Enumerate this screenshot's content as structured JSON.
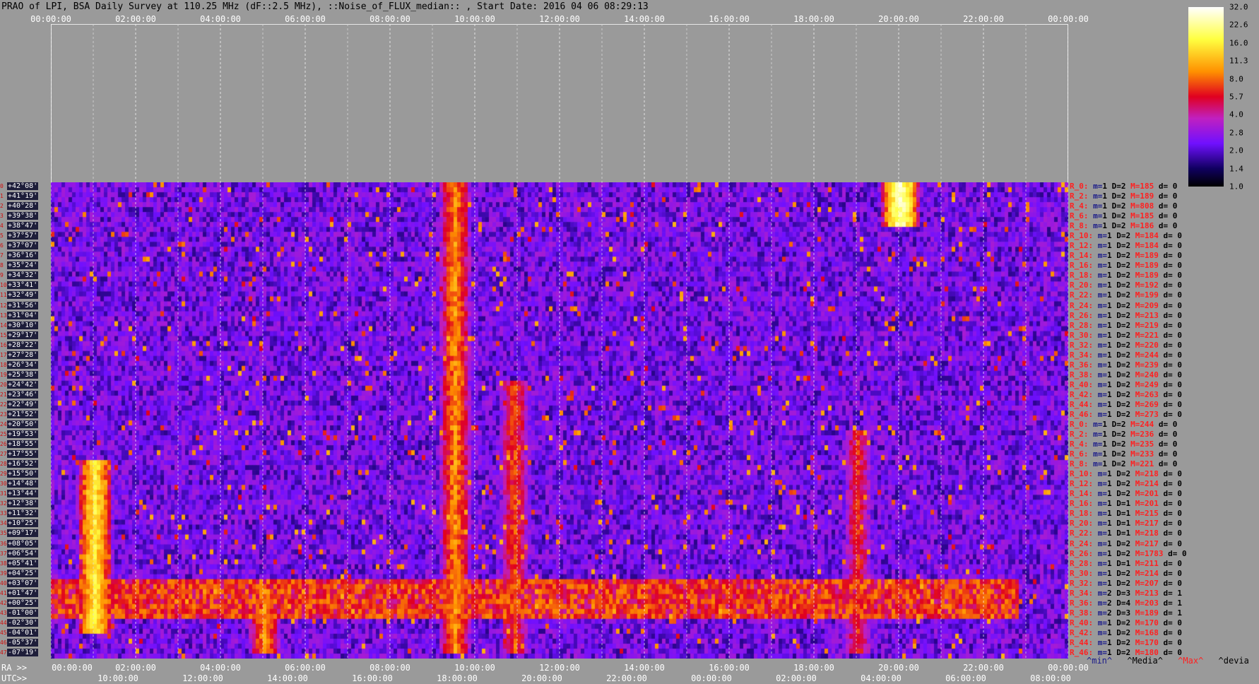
{
  "title": "PRAO of LPI, BSA Daily Survey at 110.25 MHz (dF::2.5 MHz), ::Noise_of_FLUX_median:: , Start Date: 2016 04 06 08:29:13",
  "top_axis": [
    "00:00:00",
    "02:00:00",
    "04:00:00",
    "06:00:00",
    "08:00:00",
    "10:00:00",
    "12:00:00",
    "14:00:00",
    "16:00:00",
    "18:00:00",
    "20:00:00",
    "22:00:00",
    "00:00:00"
  ],
  "ra_label": "RA >>",
  "ra_axis": [
    "00:00:00",
    "02:00:00",
    "04:00:00",
    "06:00:00",
    "08:00:00",
    "10:00:00",
    "12:00:00",
    "14:00:00",
    "16:00:00",
    "18:00:00",
    "20:00:00",
    "22:00:00",
    "00:00:00"
  ],
  "utc_label": "UTC>>",
  "utc_axis": [
    "10:00:00",
    "12:00:00",
    "14:00:00",
    "16:00:00",
    "18:00:00",
    "20:00:00",
    "22:00:00",
    "00:00:00",
    "02:00:00",
    "04:00:00",
    "06:00:00",
    "08:00:00"
  ],
  "legend_row": {
    "min": "^min^",
    "media": "^Media^",
    "max": "^Max^",
    "devia": "^devia"
  },
  "colorbar": {
    "labels": [
      "32.0",
      "22.6",
      "16.0",
      "11.3",
      "8.0",
      "5.7",
      "4.0",
      "2.8",
      "2.0",
      "1.4",
      "1.0"
    ],
    "colors": {
      "top": "#ffffff",
      "yellow": "#ffff40",
      "orange": "#ff9000",
      "red": "#e00020",
      "magenta": "#c020c0",
      "violet": "#7010ff",
      "navy": "#100060",
      "bottom": "#000000"
    }
  },
  "chart_data": {
    "type": "heatmap",
    "title": "PRAO of LPI, BSA Daily Survey at 110.25 MHz (dF::2.5 MHz), ::Noise_of_FLUX_median:: , Start Date: 2016 04 06 08:29:13",
    "xlabel": "RA >> / UTC>>",
    "x_range_ra": [
      "00:00:00",
      "24:00:00"
    ],
    "scale": "log",
    "zlim": [
      1.0,
      32.0
    ],
    "declinations": [
      "+42°08'",
      "+41°19'",
      "+40°28'",
      "+39°38'",
      "+38°47'",
      "+37°57'",
      "+37°07'",
      "+36°16'",
      "+35°24'",
      "+34°32'",
      "+33°41'",
      "+32°49'",
      "+31°56'",
      "+31°04'",
      "+30°10'",
      "+29°17'",
      "+28°22'",
      "+27°28'",
      "+26°34'",
      "+25°38'",
      "+24°42'",
      "+23°46'",
      "+22°49'",
      "+21°52'",
      "+20°50'",
      "+19°53'",
      "+18°55'",
      "+17°55'",
      "+16°52'",
      "+15°50'",
      "+14°48'",
      "+13°44'",
      "+12°38'",
      "+11°32'",
      "+10°25'",
      "+09°17'",
      "+08°05'",
      "+06°54'",
      "+05°41'",
      "+04°25'",
      "+03°07'",
      "+01°47'",
      "+00°25'",
      "-01°00'",
      "-02°30'",
      "-04°01'",
      "-05°37'",
      "-07°19'"
    ],
    "row_indices": [
      "0",
      "1",
      "2",
      "3",
      "4",
      "5",
      "6",
      "7",
      "8",
      "9",
      "10",
      "11",
      "12",
      "13",
      "14",
      "15",
      "16",
      "17",
      "18",
      "19",
      "20",
      "21",
      "22",
      "23",
      "24",
      "25",
      "26",
      "27",
      "28",
      "29",
      "30",
      "31",
      "32",
      "33",
      "34",
      "35",
      "36",
      "37",
      "38",
      "39",
      "40",
      "41",
      "42",
      "43",
      "44",
      "45",
      "46",
      "47"
    ],
    "bright_features_ra_hours": [
      {
        "ra": 9.5,
        "dec_from": 0,
        "dec_to": 47,
        "level": 12
      },
      {
        "ra": 10.9,
        "dec_from": 20,
        "dec_to": 47,
        "level": 9
      },
      {
        "ra": 20.0,
        "dec_from": 0,
        "dec_to": 4,
        "level": 32
      },
      {
        "ra": 1.0,
        "dec_from": 28,
        "dec_to": 45,
        "level": 20
      },
      {
        "ra": 5.0,
        "dec_from": 41,
        "dec_to": 47,
        "level": 12
      },
      {
        "ra": 19.0,
        "dec_from": 25,
        "dec_to": 47,
        "level": 8
      }
    ],
    "stats": [
      {
        "r": "R_0:",
        "m": "1",
        "D": "2",
        "M": "185",
        "d": "0"
      },
      {
        "r": "R_2:",
        "m": "1",
        "D": "2",
        "M": "189",
        "d": "0"
      },
      {
        "r": "R_4:",
        "m": "1",
        "D": "2",
        "M": "808",
        "d": "0"
      },
      {
        "r": "R_6:",
        "m": "1",
        "D": "2",
        "M": "185",
        "d": "0"
      },
      {
        "r": "R_8:",
        "m": "1",
        "D": "2",
        "M": "186",
        "d": "0"
      },
      {
        "r": "R_10:",
        "m": "1",
        "D": "2",
        "M": "184",
        "d": "0"
      },
      {
        "r": "R_12:",
        "m": "1",
        "D": "2",
        "M": "184",
        "d": "0"
      },
      {
        "r": "R_14:",
        "m": "1",
        "D": "2",
        "M": "189",
        "d": "0"
      },
      {
        "r": "R_16:",
        "m": "1",
        "D": "2",
        "M": "189",
        "d": "0"
      },
      {
        "r": "R_18:",
        "m": "1",
        "D": "2",
        "M": "189",
        "d": "0"
      },
      {
        "r": "R_20:",
        "m": "1",
        "D": "2",
        "M": "192",
        "d": "0"
      },
      {
        "r": "R_22:",
        "m": "1",
        "D": "2",
        "M": "199",
        "d": "0"
      },
      {
        "r": "R_24:",
        "m": "1",
        "D": "2",
        "M": "209",
        "d": "0"
      },
      {
        "r": "R_26:",
        "m": "1",
        "D": "2",
        "M": "213",
        "d": "0"
      },
      {
        "r": "R_28:",
        "m": "1",
        "D": "2",
        "M": "219",
        "d": "0"
      },
      {
        "r": "R_30:",
        "m": "1",
        "D": "2",
        "M": "221",
        "d": "0"
      },
      {
        "r": "R_32:",
        "m": "1",
        "D": "2",
        "M": "220",
        "d": "0"
      },
      {
        "r": "R_34:",
        "m": "1",
        "D": "2",
        "M": "244",
        "d": "0"
      },
      {
        "r": "R_36:",
        "m": "1",
        "D": "2",
        "M": "239",
        "d": "0"
      },
      {
        "r": "R_38:",
        "m": "1",
        "D": "2",
        "M": "240",
        "d": "0"
      },
      {
        "r": "R_40:",
        "m": "1",
        "D": "2",
        "M": "249",
        "d": "0"
      },
      {
        "r": "R_42:",
        "m": "1",
        "D": "2",
        "M": "263",
        "d": "0"
      },
      {
        "r": "R_44:",
        "m": "1",
        "D": "2",
        "M": "269",
        "d": "0"
      },
      {
        "r": "R_46:",
        "m": "1",
        "D": "2",
        "M": "273",
        "d": "0"
      },
      {
        "r": "R_0:",
        "m": "1",
        "D": "2",
        "M": "244",
        "d": "0"
      },
      {
        "r": "R_2:",
        "m": "1",
        "D": "2",
        "M": "236",
        "d": "0"
      },
      {
        "r": "R_4:",
        "m": "1",
        "D": "2",
        "M": "235",
        "d": "0"
      },
      {
        "r": "R_6:",
        "m": "1",
        "D": "2",
        "M": "233",
        "d": "0"
      },
      {
        "r": "R_8:",
        "m": "1",
        "D": "2",
        "M": "221",
        "d": "0"
      },
      {
        "r": "R_10:",
        "m": "1",
        "D": "2",
        "M": "218",
        "d": "0"
      },
      {
        "r": "R_12:",
        "m": "1",
        "D": "2",
        "M": "214",
        "d": "0"
      },
      {
        "r": "R_14:",
        "m": "1",
        "D": "2",
        "M": "201",
        "d": "0"
      },
      {
        "r": "R_16:",
        "m": "1",
        "D": "1",
        "M": "201",
        "d": "0"
      },
      {
        "r": "R_18:",
        "m": "1",
        "D": "1",
        "M": "215",
        "d": "0"
      },
      {
        "r": "R_20:",
        "m": "1",
        "D": "1",
        "M": "217",
        "d": "0"
      },
      {
        "r": "R_22:",
        "m": "1",
        "D": "1",
        "M": "218",
        "d": "0"
      },
      {
        "r": "R_24:",
        "m": "1",
        "D": "2",
        "M": "217",
        "d": "0"
      },
      {
        "r": "R_26:",
        "m": "1",
        "D": "2",
        "M": "1783",
        "d": "0"
      },
      {
        "r": "R_28:",
        "m": "1",
        "D": "1",
        "M": "211",
        "d": "0"
      },
      {
        "r": "R_30:",
        "m": "1",
        "D": "2",
        "M": "214",
        "d": "0"
      },
      {
        "r": "R_32:",
        "m": "1",
        "D": "2",
        "M": "207",
        "d": "0"
      },
      {
        "r": "R_34:",
        "m": "2",
        "D": "3",
        "M": "213",
        "d": "1"
      },
      {
        "r": "R_36:",
        "m": "2",
        "D": "4",
        "M": "203",
        "d": "1"
      },
      {
        "r": "R_38:",
        "m": "2",
        "D": "3",
        "M": "189",
        "d": "1"
      },
      {
        "r": "R_40:",
        "m": "1",
        "D": "2",
        "M": "170",
        "d": "0"
      },
      {
        "r": "R_42:",
        "m": "1",
        "D": "2",
        "M": "168",
        "d": "0"
      },
      {
        "r": "R_44:",
        "m": "1",
        "D": "2",
        "M": "170",
        "d": "0"
      },
      {
        "r": "R_46:",
        "m": "1",
        "D": "2",
        "M": "180",
        "d": "0"
      }
    ]
  }
}
